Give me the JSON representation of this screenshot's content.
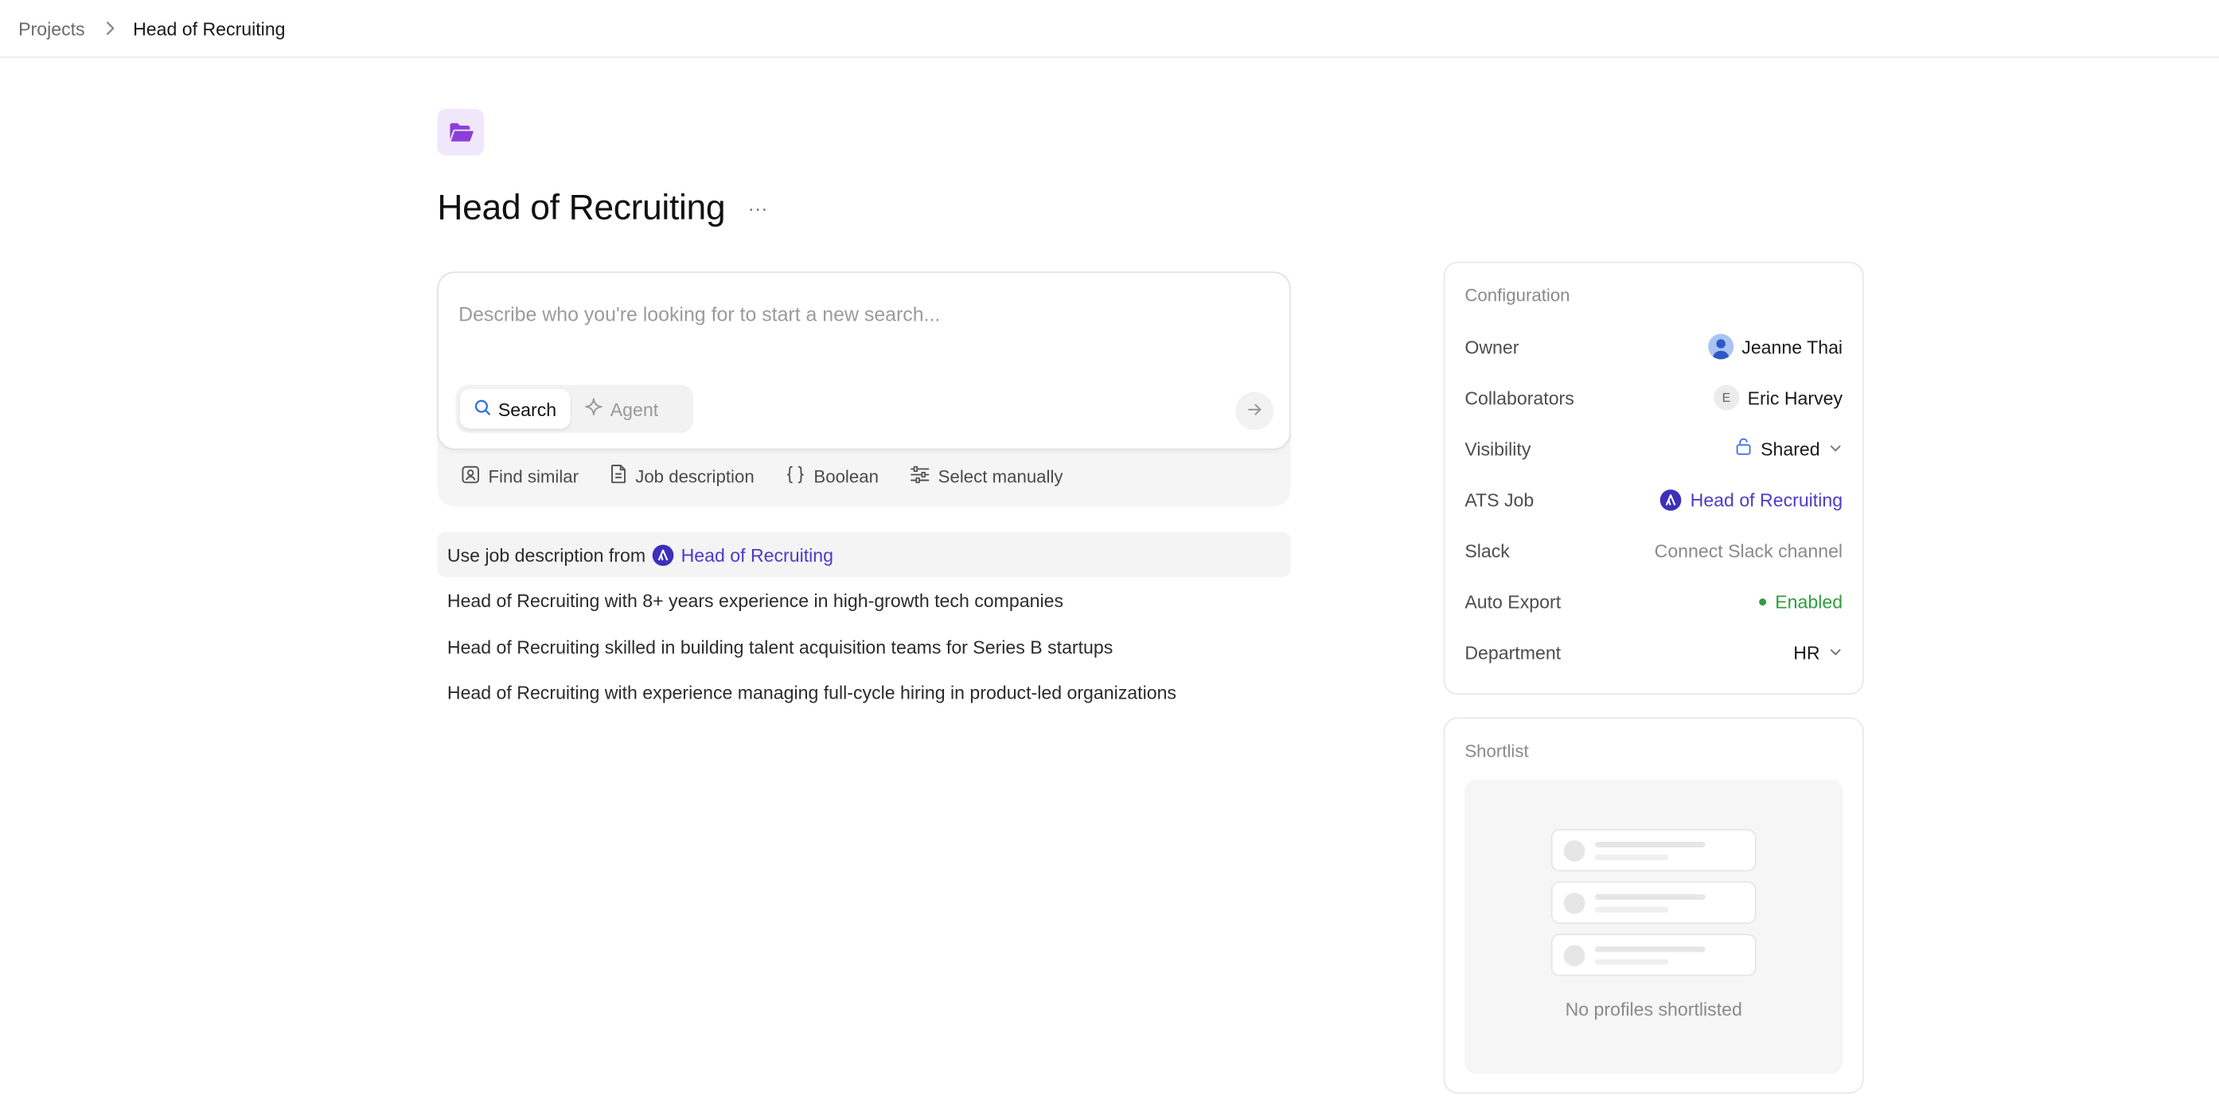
{
  "breadcrumb": {
    "root": "Projects",
    "current": "Head of Recruiting"
  },
  "project": {
    "icon": "folder-open-icon",
    "accent": "#8b3fd9",
    "title": "Head of Recruiting",
    "more": "···"
  },
  "composer": {
    "placeholder": "Describe who you're looking for to start a new search...",
    "modes": [
      {
        "label": "Search",
        "icon": "search-icon",
        "active": true
      },
      {
        "label": "Agent",
        "icon": "sparkle-icon",
        "active": false
      }
    ],
    "send_icon": "arrow-right-icon",
    "quick_actions": [
      {
        "label": "Find similar",
        "icon": "person-card-icon"
      },
      {
        "label": "Job description",
        "icon": "document-icon"
      },
      {
        "label": "Boolean",
        "icon": "braces-icon"
      },
      {
        "label": "Select manually",
        "icon": "sliders-icon"
      }
    ]
  },
  "suggestions": {
    "first_prefix": "Use job description from",
    "first_link": "Head of Recruiting",
    "items": [
      "Head of Recruiting with 8+ years experience in high-growth tech companies",
      "Head of Recruiting skilled in building talent acquisition teams for Series B startups",
      "Head of Recruiting with experience managing full-cycle hiring in product-led organizations"
    ]
  },
  "configuration": {
    "header": "Configuration",
    "owner": {
      "label": "Owner",
      "value": "Jeanne Thai"
    },
    "collaborators": {
      "label": "Collaborators",
      "value": "Eric Harvey",
      "initial": "E"
    },
    "visibility": {
      "label": "Visibility",
      "value": "Shared"
    },
    "ats_job": {
      "label": "ATS Job",
      "value": "Head of Recruiting",
      "color": "#4a3cc9"
    },
    "slack": {
      "label": "Slack",
      "value": "Connect Slack channel"
    },
    "auto_export": {
      "label": "Auto Export",
      "value": "Enabled",
      "color": "#2f9e3f"
    },
    "department": {
      "label": "Department",
      "value": "HR"
    }
  },
  "shortlist": {
    "header": "Shortlist",
    "empty_text": "No profiles shortlisted"
  }
}
